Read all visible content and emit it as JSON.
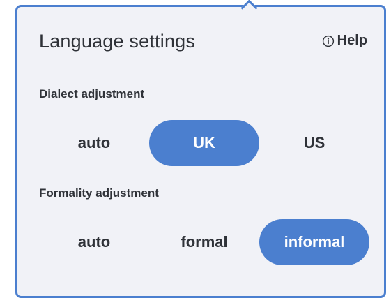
{
  "panel": {
    "title": "Language settings",
    "help_label": "Help"
  },
  "dialect": {
    "label": "Dialect adjustment",
    "options": [
      "auto",
      "UK",
      "US"
    ],
    "selected": "UK"
  },
  "formality": {
    "label": "Formality adjustment",
    "options": [
      "auto",
      "formal",
      "informal"
    ],
    "selected": "informal"
  },
  "colors": {
    "accent": "#4b7fcf",
    "panel_bg": "#f1f2f7",
    "text": "#2f3238"
  },
  "icons": {
    "help": "info-circle-icon"
  }
}
